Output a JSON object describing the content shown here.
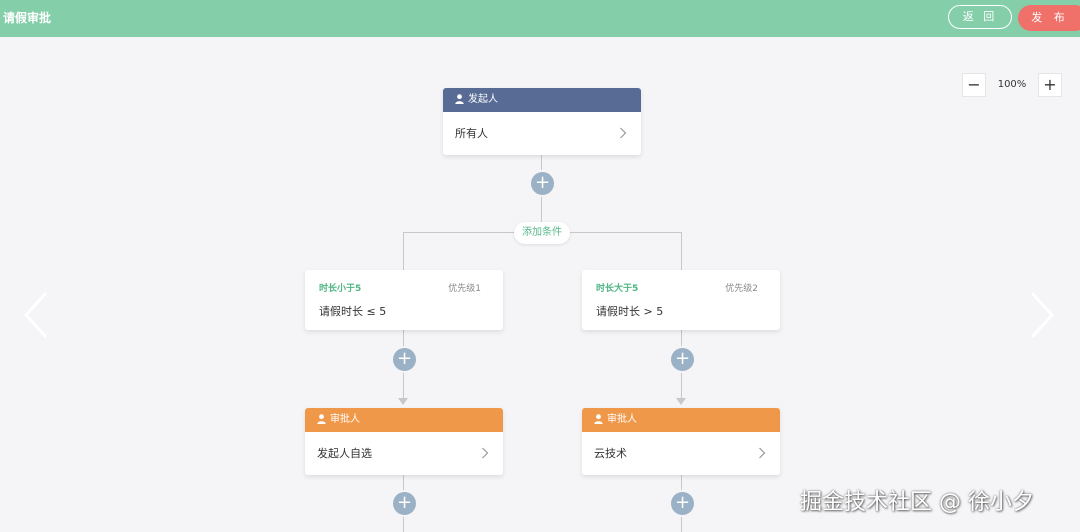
{
  "app": {
    "title": "请假审批"
  },
  "toolbar": {
    "back_label": "返 回",
    "publish_label": "发 布"
  },
  "zoom": {
    "minus": "−",
    "level": "100%",
    "plus": "+"
  },
  "initiator": {
    "header": "发起人",
    "value": "所有人"
  },
  "add_condition_label": "添加条件",
  "conditions": [
    {
      "title": "时长小于5",
      "priority": "优先级1",
      "content": "请假时长 ≤ 5"
    },
    {
      "title": "时长大于5",
      "priority": "优先级2",
      "content": "请假时长 > 5"
    }
  ],
  "approvers": [
    {
      "header": "审批人",
      "value": "发起人自选"
    },
    {
      "header": "审批人",
      "value": "云技术"
    }
  ],
  "add_symbol": "+",
  "watermark": "掘金技术社区 @ 徐小夕",
  "colors": {
    "topbar": "#84cfaa",
    "publish": "#f0706a",
    "initiator_header": "#576b95",
    "approver_header": "#f0984a",
    "condition_title": "#4fb583",
    "add_circle": "#9ab1c6"
  },
  "icons": [
    "person-icon",
    "chevron-right-icon",
    "plus-icon",
    "minus-icon",
    "arrow-left-icon",
    "arrow-right-icon"
  ]
}
